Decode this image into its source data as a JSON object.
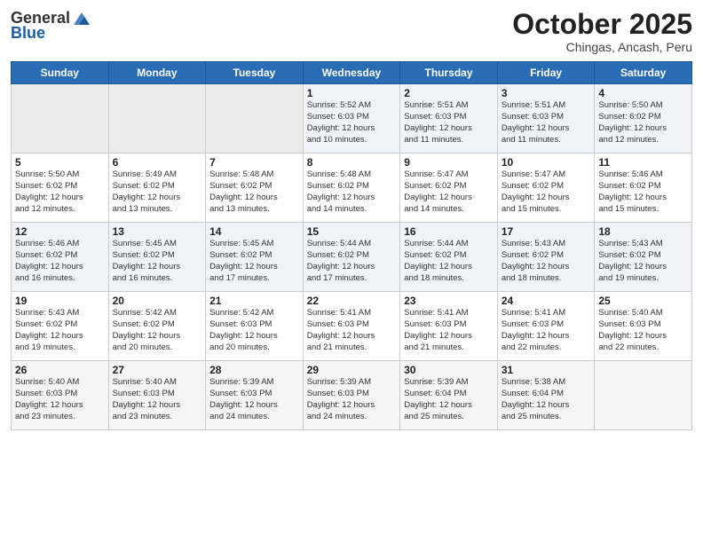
{
  "header": {
    "logo_general": "General",
    "logo_blue": "Blue",
    "month": "October 2025",
    "location": "Chingas, Ancash, Peru"
  },
  "days_of_week": [
    "Sunday",
    "Monday",
    "Tuesday",
    "Wednesday",
    "Thursday",
    "Friday",
    "Saturday"
  ],
  "weeks": [
    [
      {
        "day": "",
        "info": ""
      },
      {
        "day": "",
        "info": ""
      },
      {
        "day": "",
        "info": ""
      },
      {
        "day": "1",
        "info": "Sunrise: 5:52 AM\nSunset: 6:03 PM\nDaylight: 12 hours\nand 10 minutes."
      },
      {
        "day": "2",
        "info": "Sunrise: 5:51 AM\nSunset: 6:03 PM\nDaylight: 12 hours\nand 11 minutes."
      },
      {
        "day": "3",
        "info": "Sunrise: 5:51 AM\nSunset: 6:03 PM\nDaylight: 12 hours\nand 11 minutes."
      },
      {
        "day": "4",
        "info": "Sunrise: 5:50 AM\nSunset: 6:02 PM\nDaylight: 12 hours\nand 12 minutes."
      }
    ],
    [
      {
        "day": "5",
        "info": "Sunrise: 5:50 AM\nSunset: 6:02 PM\nDaylight: 12 hours\nand 12 minutes."
      },
      {
        "day": "6",
        "info": "Sunrise: 5:49 AM\nSunset: 6:02 PM\nDaylight: 12 hours\nand 13 minutes."
      },
      {
        "day": "7",
        "info": "Sunrise: 5:48 AM\nSunset: 6:02 PM\nDaylight: 12 hours\nand 13 minutes."
      },
      {
        "day": "8",
        "info": "Sunrise: 5:48 AM\nSunset: 6:02 PM\nDaylight: 12 hours\nand 14 minutes."
      },
      {
        "day": "9",
        "info": "Sunrise: 5:47 AM\nSunset: 6:02 PM\nDaylight: 12 hours\nand 14 minutes."
      },
      {
        "day": "10",
        "info": "Sunrise: 5:47 AM\nSunset: 6:02 PM\nDaylight: 12 hours\nand 15 minutes."
      },
      {
        "day": "11",
        "info": "Sunrise: 5:46 AM\nSunset: 6:02 PM\nDaylight: 12 hours\nand 15 minutes."
      }
    ],
    [
      {
        "day": "12",
        "info": "Sunrise: 5:46 AM\nSunset: 6:02 PM\nDaylight: 12 hours\nand 16 minutes."
      },
      {
        "day": "13",
        "info": "Sunrise: 5:45 AM\nSunset: 6:02 PM\nDaylight: 12 hours\nand 16 minutes."
      },
      {
        "day": "14",
        "info": "Sunrise: 5:45 AM\nSunset: 6:02 PM\nDaylight: 12 hours\nand 17 minutes."
      },
      {
        "day": "15",
        "info": "Sunrise: 5:44 AM\nSunset: 6:02 PM\nDaylight: 12 hours\nand 17 minutes."
      },
      {
        "day": "16",
        "info": "Sunrise: 5:44 AM\nSunset: 6:02 PM\nDaylight: 12 hours\nand 18 minutes."
      },
      {
        "day": "17",
        "info": "Sunrise: 5:43 AM\nSunset: 6:02 PM\nDaylight: 12 hours\nand 18 minutes."
      },
      {
        "day": "18",
        "info": "Sunrise: 5:43 AM\nSunset: 6:02 PM\nDaylight: 12 hours\nand 19 minutes."
      }
    ],
    [
      {
        "day": "19",
        "info": "Sunrise: 5:43 AM\nSunset: 6:02 PM\nDaylight: 12 hours\nand 19 minutes."
      },
      {
        "day": "20",
        "info": "Sunrise: 5:42 AM\nSunset: 6:02 PM\nDaylight: 12 hours\nand 20 minutes."
      },
      {
        "day": "21",
        "info": "Sunrise: 5:42 AM\nSunset: 6:03 PM\nDaylight: 12 hours\nand 20 minutes."
      },
      {
        "day": "22",
        "info": "Sunrise: 5:41 AM\nSunset: 6:03 PM\nDaylight: 12 hours\nand 21 minutes."
      },
      {
        "day": "23",
        "info": "Sunrise: 5:41 AM\nSunset: 6:03 PM\nDaylight: 12 hours\nand 21 minutes."
      },
      {
        "day": "24",
        "info": "Sunrise: 5:41 AM\nSunset: 6:03 PM\nDaylight: 12 hours\nand 22 minutes."
      },
      {
        "day": "25",
        "info": "Sunrise: 5:40 AM\nSunset: 6:03 PM\nDaylight: 12 hours\nand 22 minutes."
      }
    ],
    [
      {
        "day": "26",
        "info": "Sunrise: 5:40 AM\nSunset: 6:03 PM\nDaylight: 12 hours\nand 23 minutes."
      },
      {
        "day": "27",
        "info": "Sunrise: 5:40 AM\nSunset: 6:03 PM\nDaylight: 12 hours\nand 23 minutes."
      },
      {
        "day": "28",
        "info": "Sunrise: 5:39 AM\nSunset: 6:03 PM\nDaylight: 12 hours\nand 24 minutes."
      },
      {
        "day": "29",
        "info": "Sunrise: 5:39 AM\nSunset: 6:03 PM\nDaylight: 12 hours\nand 24 minutes."
      },
      {
        "day": "30",
        "info": "Sunrise: 5:39 AM\nSunset: 6:04 PM\nDaylight: 12 hours\nand 25 minutes."
      },
      {
        "day": "31",
        "info": "Sunrise: 5:38 AM\nSunset: 6:04 PM\nDaylight: 12 hours\nand 25 minutes."
      },
      {
        "day": "",
        "info": ""
      }
    ]
  ]
}
